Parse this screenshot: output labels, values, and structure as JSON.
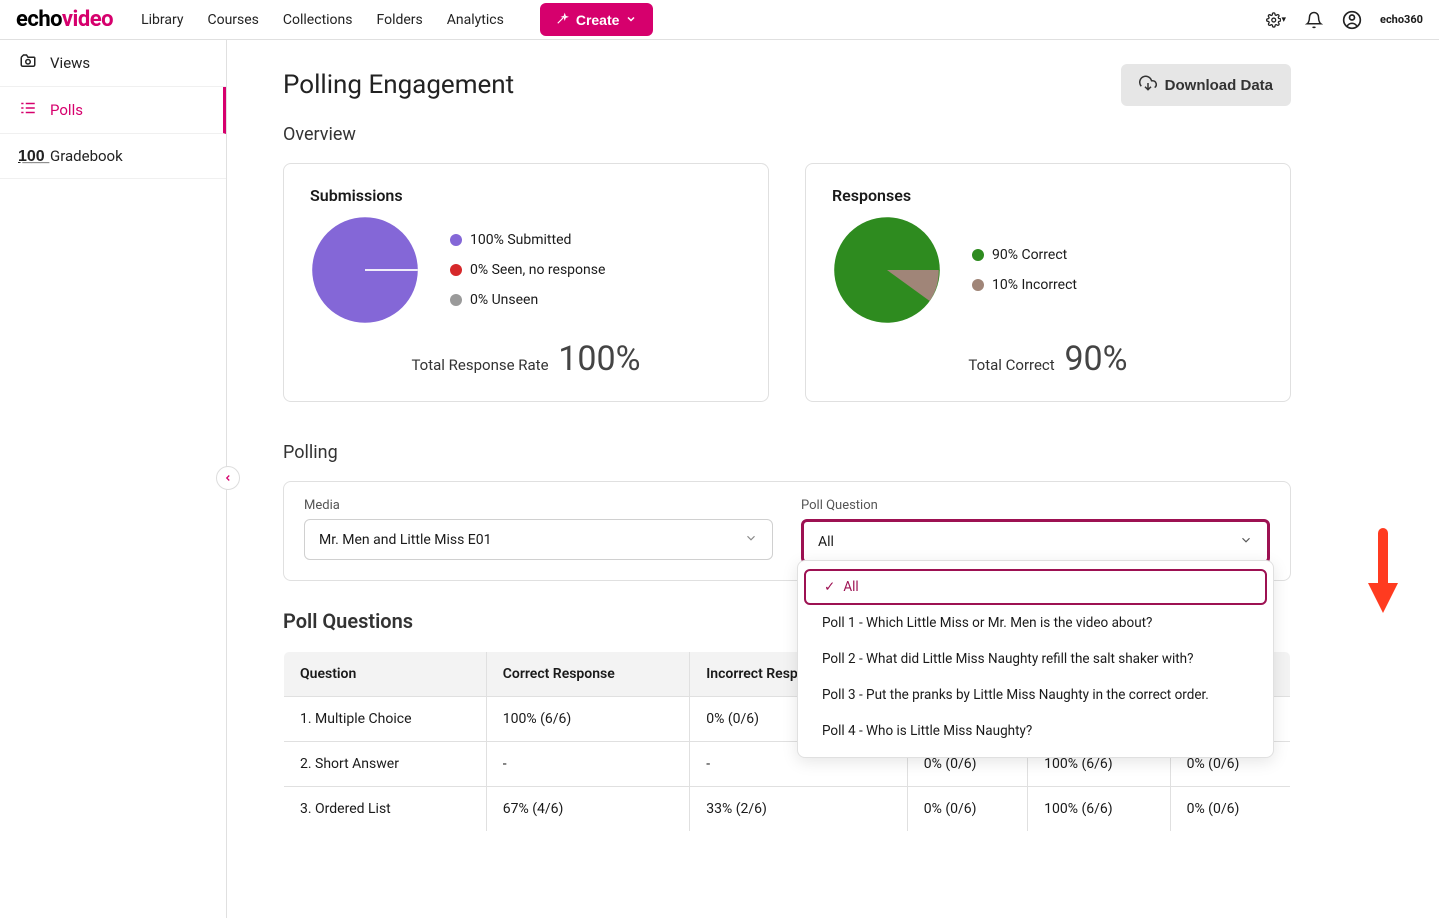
{
  "brand": {
    "part1": "echo",
    "part2": "video",
    "small": "echo360"
  },
  "nav": {
    "library": "Library",
    "courses": "Courses",
    "collections": "Collections",
    "folders": "Folders",
    "analytics": "Analytics",
    "create": "Create"
  },
  "sidebar": {
    "items": [
      {
        "label": "Views"
      },
      {
        "label": "Polls"
      },
      {
        "label": "Gradebook"
      }
    ]
  },
  "page": {
    "title": "Polling Engagement",
    "download": "Download Data",
    "overview": "Overview",
    "polling": "Polling",
    "poll_questions": "Poll Questions"
  },
  "submissions": {
    "title": "Submissions",
    "legend": [
      {
        "label": "100% Submitted",
        "color": "#8467d7"
      },
      {
        "label": "0% Seen, no response",
        "color": "#d6282a"
      },
      {
        "label": "0% Unseen",
        "color": "#9a9a9a"
      }
    ],
    "foot_label": "Total Response Rate",
    "foot_val": "100%"
  },
  "responses": {
    "title": "Responses",
    "legend": [
      {
        "label": "90% Correct",
        "color": "#2e8b1f"
      },
      {
        "label": "10% Incorrect",
        "color": "#a08578"
      }
    ],
    "foot_label": "Total Correct",
    "foot_val": "90%"
  },
  "filters": {
    "media_label": "Media",
    "media_value": "Mr. Men and Little Miss E01",
    "poll_label": "Poll Question",
    "poll_value": "All",
    "options": [
      "All",
      "Poll 1 - Which Little Miss or Mr. Men is the video about?",
      "Poll 2 - What did Little Miss Naughty refill the salt shaker with?",
      "Poll 3 - Put the pranks by Little Miss Naughty in the correct order.",
      "Poll 4 - Who is Little Miss Naughty?"
    ]
  },
  "table": {
    "headers": [
      "Question",
      "Correct Response",
      "Incorrect Response",
      "",
      "",
      ""
    ],
    "rows": [
      [
        "1. Multiple Choice",
        "100% (6/6)",
        "0% (0/6)",
        "",
        "",
        ""
      ],
      [
        "2. Short Answer",
        "-",
        "-",
        "0% (0/6)",
        "100% (6/6)",
        "0% (0/6)"
      ],
      [
        "3. Ordered List",
        "67% (4/6)",
        "33% (2/6)",
        "0% (0/6)",
        "100% (6/6)",
        "0% (0/6)"
      ]
    ]
  },
  "chart_data": [
    {
      "type": "pie",
      "title": "Submissions",
      "series": [
        {
          "name": "Submitted",
          "value": 100,
          "color": "#8467d7"
        },
        {
          "name": "Seen, no response",
          "value": 0,
          "color": "#d6282a"
        },
        {
          "name": "Unseen",
          "value": 0,
          "color": "#9a9a9a"
        }
      ]
    },
    {
      "type": "pie",
      "title": "Responses",
      "series": [
        {
          "name": "Correct",
          "value": 90,
          "color": "#2e8b1f"
        },
        {
          "name": "Incorrect",
          "value": 10,
          "color": "#a08578"
        }
      ]
    }
  ]
}
